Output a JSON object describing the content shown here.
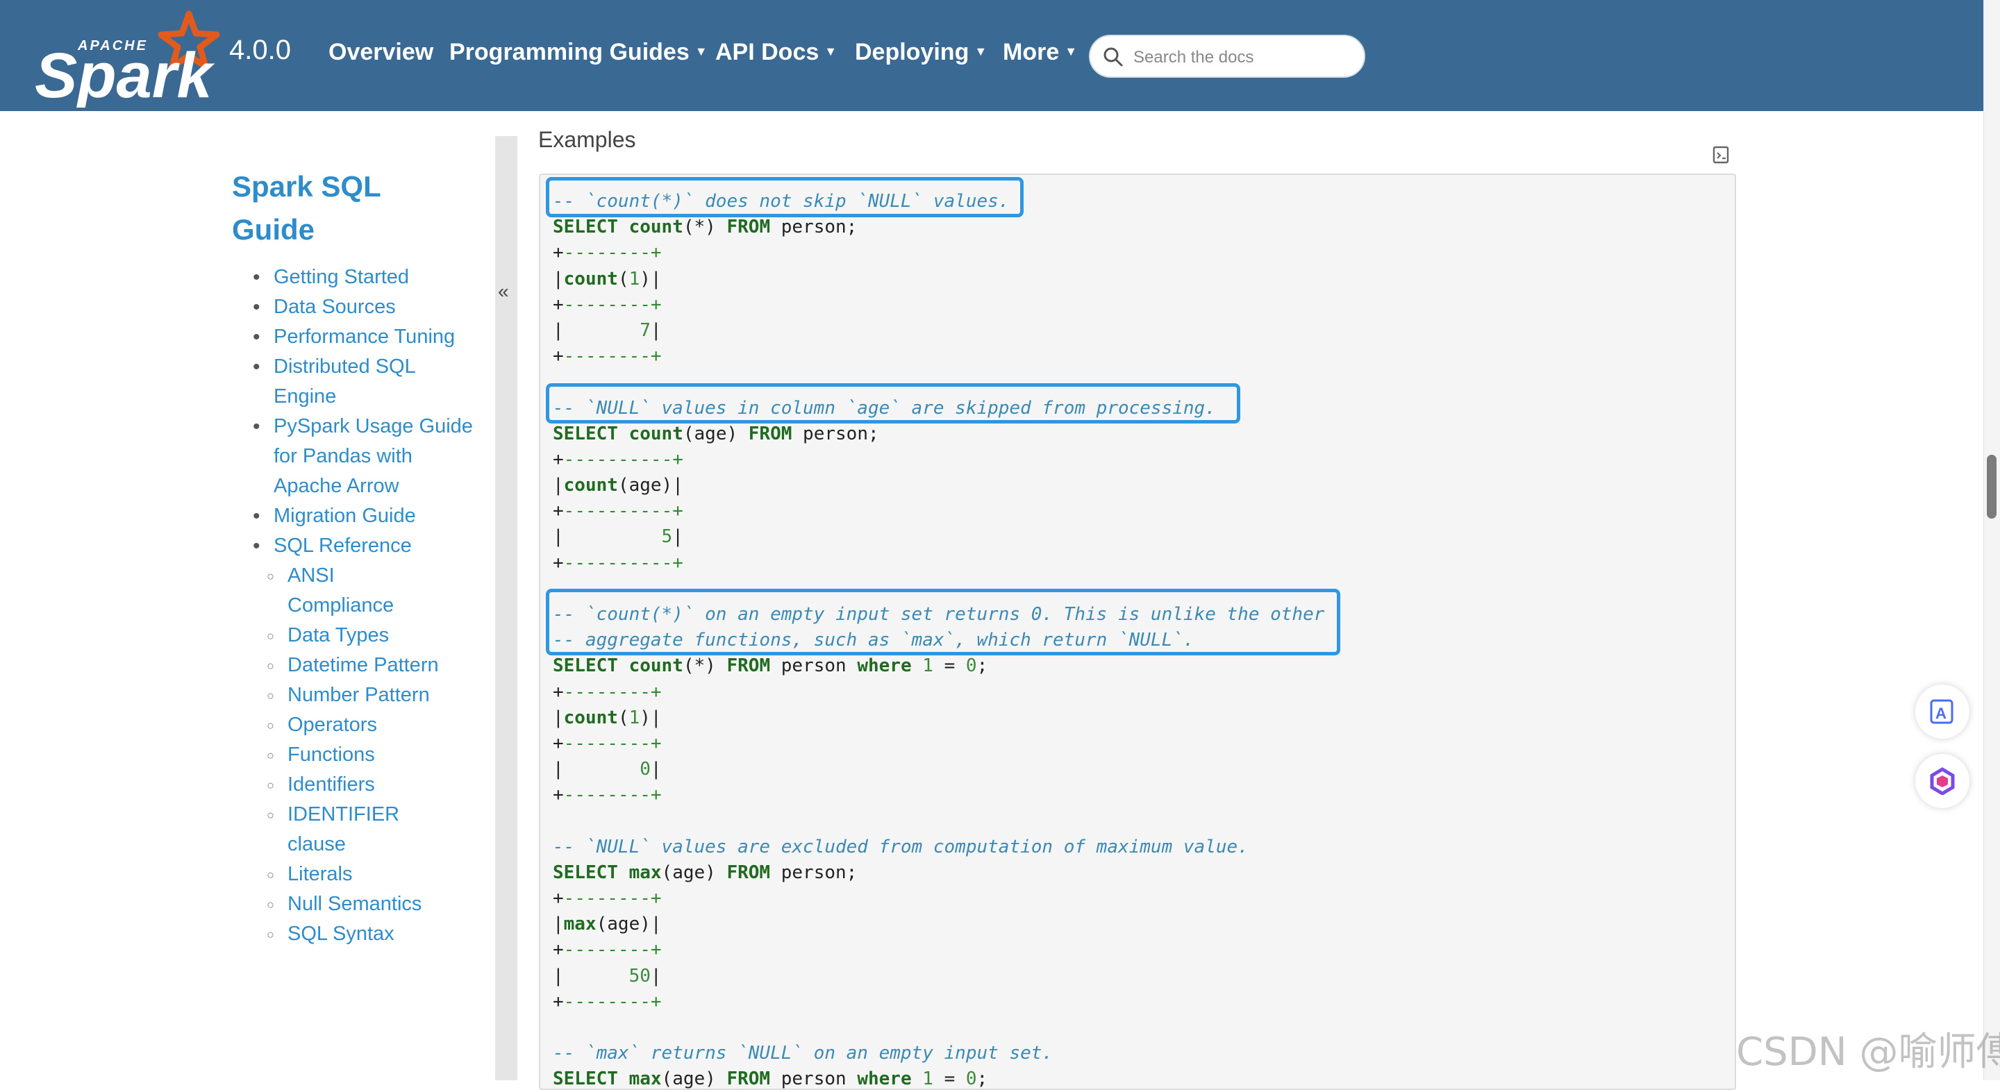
{
  "header": {
    "logo_text": "APACHE Spark",
    "version": "4.0.0",
    "nav": [
      {
        "label": "Overview",
        "dropdown": false
      },
      {
        "label": "Programming Guides",
        "dropdown": true
      },
      {
        "label": "API Docs",
        "dropdown": true
      },
      {
        "label": "Deploying",
        "dropdown": true
      },
      {
        "label": "More",
        "dropdown": true
      }
    ],
    "search_placeholder": "Search the docs"
  },
  "sidebar": {
    "title_line1": "Spark SQL",
    "title_line2": "Guide",
    "items": [
      {
        "label": "Getting Started"
      },
      {
        "label": "Data Sources"
      },
      {
        "label": "Performance Tuning"
      },
      {
        "label": "Distributed SQL Engine"
      },
      {
        "label": "PySpark Usage Guide for Pandas with Apache Arrow"
      },
      {
        "label": "Migration Guide"
      },
      {
        "label": "SQL Reference"
      }
    ],
    "subitems": [
      {
        "label": "ANSI Compliance"
      },
      {
        "label": "Data Types"
      },
      {
        "label": "Datetime Pattern"
      },
      {
        "label": "Number Pattern"
      },
      {
        "label": "Operators"
      },
      {
        "label": "Functions"
      },
      {
        "label": "Identifiers"
      },
      {
        "label": "IDENTIFIER clause"
      },
      {
        "label": "Literals"
      },
      {
        "label": "Null Semantics"
      },
      {
        "label": "SQL Syntax"
      }
    ],
    "collapse_glyph": "«"
  },
  "main": {
    "heading": "Examples",
    "code_lines": [
      "-- `count(*)` does not skip `NULL` values.",
      "SELECT count(*) FROM person;",
      "+--------+",
      "|count(1)|",
      "+--------+",
      "|       7|",
      "+--------+",
      "",
      "-- `NULL` values in column `age` are skipped from processing.",
      "SELECT count(age) FROM person;",
      "+----------+",
      "|count(age)|",
      "+----------+",
      "|         5|",
      "+----------+",
      "",
      "-- `count(*)` on an empty input set returns 0. This is unlike the other",
      "-- aggregate functions, such as `max`, which return `NULL`.",
      "SELECT count(*) FROM person where 1 = 0;",
      "+--------+",
      "|count(1)|",
      "+--------+",
      "|       0|",
      "+--------+",
      "",
      "-- `NULL` values are excluded from computation of maximum value.",
      "SELECT max(age) FROM person;",
      "+--------+",
      "|max(age)|",
      "+--------+",
      "|      50|",
      "+--------+",
      "",
      "-- `max` returns `NULL` on an empty input set.",
      "SELECT max(age) FROM person where 1 = 0;"
    ]
  },
  "watermark": "CSDN @喻师傅",
  "colors": {
    "navbar": "#3a6a93",
    "link": "#2e8ccb",
    "highlight_box": "#2f97e2",
    "code_comment": "#3a8ab5",
    "code_keyword": "#1f6b1f",
    "spark_orange": "#e25a1c"
  },
  "icons": [
    "search-icon",
    "copy-icon",
    "translate-icon",
    "assistant-icon",
    "collapse-icon"
  ]
}
